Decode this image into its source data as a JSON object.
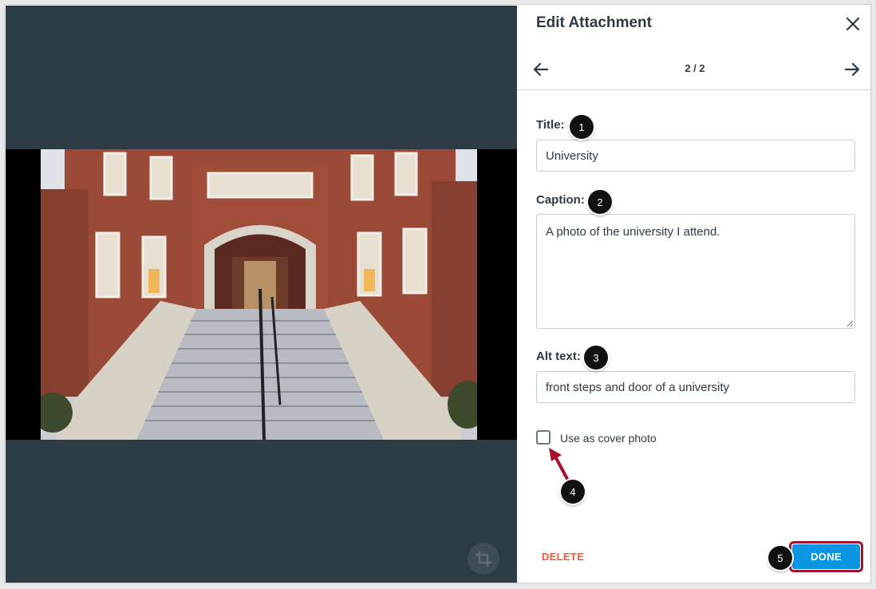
{
  "dialog": {
    "title": "Edit Attachment",
    "counter": "2 / 2",
    "close_icon": "close-icon",
    "prev_icon": "arrow-left-icon",
    "next_icon": "arrow-right-icon"
  },
  "form": {
    "title_label": "Title:",
    "title_value": "University",
    "caption_label": "Caption:",
    "caption_value": "A photo of the university I attend.",
    "alt_label": "Alt text:",
    "alt_value": "front steps and door of a university",
    "cover_label": "Use as cover photo",
    "cover_checked": false
  },
  "actions": {
    "delete_label": "DELETE",
    "done_label": "DONE"
  },
  "callouts": [
    "1",
    "2",
    "3",
    "4",
    "5"
  ],
  "colors": {
    "preview_bg": "#2d3b45",
    "primary": "#0b96e3",
    "danger": "#ef5a35",
    "highlight": "#a5122c"
  }
}
